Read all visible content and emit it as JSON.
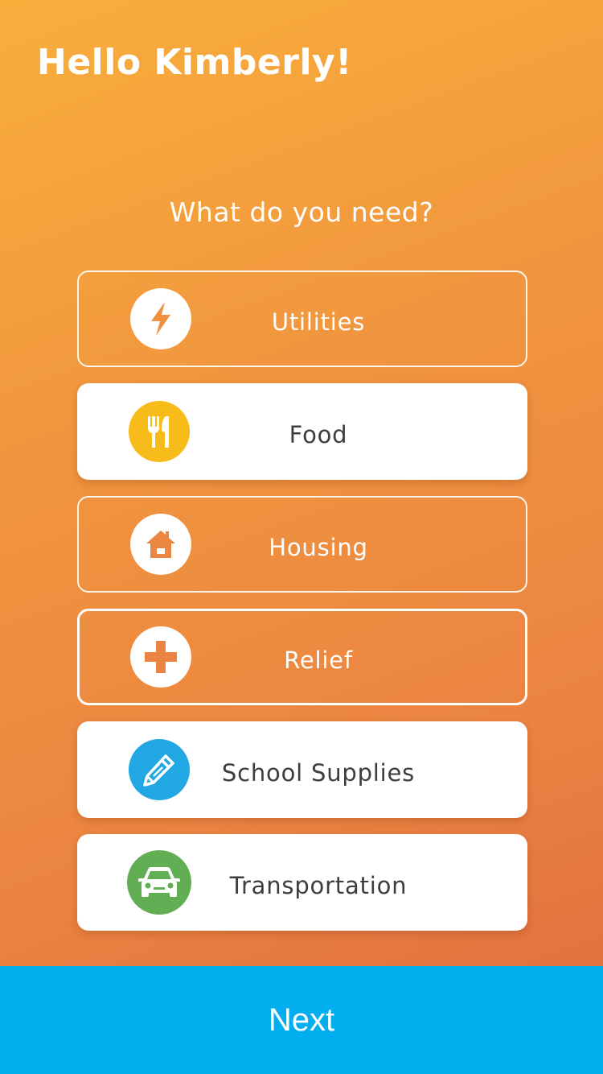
{
  "header": {
    "greeting": "Hello Kimberly!"
  },
  "main": {
    "question": "What do you need?",
    "options": [
      {
        "label": "Utilities",
        "icon": "lightning-bolt-icon",
        "selected": false,
        "icon_bg": "#FFFFFF",
        "icon_fg": "#F0913E"
      },
      {
        "label": "Food",
        "icon": "fork-knife-icon",
        "selected": true,
        "icon_bg": "#F8BC1A",
        "icon_fg": "#FFFFFF"
      },
      {
        "label": "Housing",
        "icon": "house-icon",
        "selected": false,
        "icon_bg": "#FFFFFF",
        "icon_fg": "#EC8742"
      },
      {
        "label": "Relief",
        "icon": "plus-cross-icon",
        "selected": false,
        "icon_bg": "#FFFFFF",
        "icon_fg": "#EB8442"
      },
      {
        "label": "School Supplies",
        "icon": "pencil-icon",
        "selected": true,
        "icon_bg": "#21A8E4",
        "icon_fg": "#FFFFFF"
      },
      {
        "label": "Transportation",
        "icon": "car-icon",
        "selected": true,
        "icon_bg": "#62AE55",
        "icon_fg": "#FFFFFF"
      }
    ]
  },
  "footer": {
    "next_label": "Next"
  },
  "colors": {
    "gradient_start": "#F9AE3C",
    "gradient_end": "#E06A3E",
    "next_bar": "#03AEEF",
    "selected_text": "#3D3D3D"
  }
}
